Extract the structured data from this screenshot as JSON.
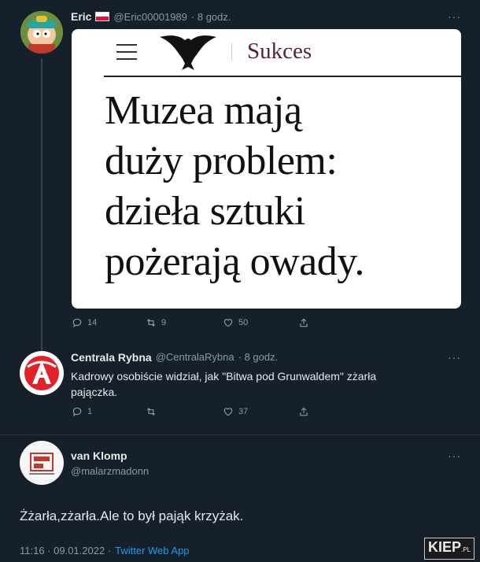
{
  "tweet1": {
    "name": "Eric",
    "flag_icon": "flag-poland-icon",
    "handle": "@Eric00001989",
    "time": "· 8 godz.",
    "more": "···",
    "card": {
      "brand": "Sukces",
      "headline_lines": [
        "Muzea mają",
        "duży problem:",
        "dzieła sztuki",
        "pożerają owady."
      ]
    },
    "actions": {
      "replies": "14",
      "retweets": "9",
      "likes": "50"
    }
  },
  "tweet2": {
    "name": "Centrala Rybna",
    "handle": "@CentralaRybna",
    "time": "· 8 godz.",
    "more": "···",
    "text_line1": "Kadrowy osobiście widział, jak \"Bitwa pod Grunwaldem\" zżarła",
    "text_line2": "pajączka.",
    "actions": {
      "replies": "1",
      "retweets": "",
      "likes": "37"
    }
  },
  "tweet3": {
    "name": "van Klomp",
    "handle": "@malarzmadonn",
    "more": "···",
    "text": "Żżarła,zżarła.Ale to był pająk krzyżak.",
    "time": "11:16 · 09.01.2022 ·",
    "app": "Twitter Web App"
  },
  "watermark": {
    "main": "KIEP",
    "suffix": ".PL"
  },
  "colors": {
    "background": "#15202b",
    "secondary_text": "#8b98a5",
    "link": "#1d9bf0",
    "card": "#ffffff"
  }
}
